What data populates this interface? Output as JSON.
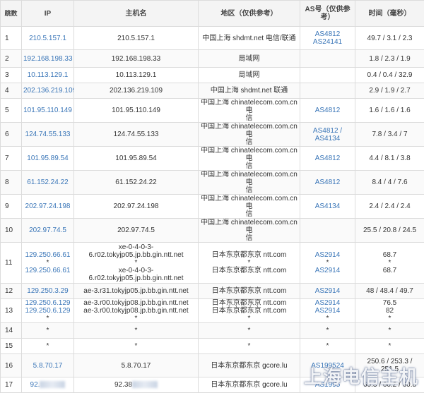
{
  "headers": {
    "hop": "跳数",
    "ip": "IP",
    "host": "主机名",
    "region": "地区（仅供参考）",
    "as": "AS号（仅供参考）",
    "time": "时间（毫秒）"
  },
  "rows": [
    {
      "hop": "1",
      "ip": [
        "210.5.157.1"
      ],
      "host": [
        "210.5.157.1"
      ],
      "region": [
        "中国上海 shdmt.net 电信/联通"
      ],
      "as": [
        "AS4812",
        "AS24141"
      ],
      "time": [
        "49.7 / 3.1 / 2.3"
      ]
    },
    {
      "hop": "2",
      "ip": [
        "192.168.198.33"
      ],
      "host": [
        "192.168.198.33"
      ],
      "region": [
        "局域网"
      ],
      "as": [],
      "time": [
        "1.8 / 2.3 / 1.9"
      ]
    },
    {
      "hop": "3",
      "ip": [
        "10.113.129.1"
      ],
      "host": [
        "10.113.129.1"
      ],
      "region": [
        "局域网"
      ],
      "as": [],
      "time": [
        "0.4 / 0.4 / 32.9"
      ]
    },
    {
      "hop": "4",
      "ip": [
        "202.136.219.109"
      ],
      "host": [
        "202.136.219.109"
      ],
      "region": [
        "中国上海 shdmt.net 联通"
      ],
      "as": [],
      "time": [
        "2.9 / 1.9 / 2.7"
      ]
    },
    {
      "hop": "5",
      "ip": [
        "101.95.110.149"
      ],
      "host": [
        "101.95.110.149"
      ],
      "region": [
        "中国上海 chinatelecom.com.cn 电",
        "信"
      ],
      "as": [
        "AS4812"
      ],
      "time": [
        "1.6 / 1.6 / 1.6"
      ]
    },
    {
      "hop": "6",
      "ip": [
        "124.74.55.133"
      ],
      "host": [
        "124.74.55.133"
      ],
      "region": [
        "中国上海 chinatelecom.com.cn 电",
        "信"
      ],
      "as": [
        "AS4812 / AS4134"
      ],
      "time": [
        "7.8 / 3.4 / 7"
      ]
    },
    {
      "hop": "7",
      "ip": [
        "101.95.89.54"
      ],
      "host": [
        "101.95.89.54"
      ],
      "region": [
        "中国上海 chinatelecom.com.cn 电",
        "信"
      ],
      "as": [
        "AS4812"
      ],
      "time": [
        "4.4 / 8.1 / 3.8"
      ]
    },
    {
      "hop": "8",
      "ip": [
        "61.152.24.22"
      ],
      "host": [
        "61.152.24.22"
      ],
      "region": [
        "中国上海 chinatelecom.com.cn 电",
        "信"
      ],
      "as": [
        "AS4812"
      ],
      "time": [
        "8.4 / 4 / 7.6"
      ]
    },
    {
      "hop": "9",
      "ip": [
        "202.97.24.198"
      ],
      "host": [
        "202.97.24.198"
      ],
      "region": [
        "中国上海 chinatelecom.com.cn 电",
        "信"
      ],
      "as": [
        "AS4134"
      ],
      "time": [
        "2.4 / 2.4 / 2.4"
      ]
    },
    {
      "hop": "10",
      "ip": [
        "202.97.74.5"
      ],
      "host": [
        "202.97.74.5"
      ],
      "region": [
        "中国上海 chinatelecom.com.cn 电",
        "信"
      ],
      "as": [],
      "time": [
        "25.5 / 20.8 / 24.5"
      ]
    },
    {
      "hop": "11",
      "ip": [
        "129.250.66.61",
        "*",
        "129.250.66.61"
      ],
      "host": [
        "xe-0-4-0-3-",
        "6.r02.tokyjp05.jp.bb.gin.ntt.net",
        "*",
        "xe-0-4-0-3-",
        "6.r02.tokyjp05.jp.bb.gin.ntt.net"
      ],
      "region": [
        "日本东京都东京 ntt.com",
        "*",
        "日本东京都东京 ntt.com"
      ],
      "as": [
        "AS2914",
        "*",
        "AS2914"
      ],
      "time": [
        "68.7",
        "*",
        "68.7"
      ]
    },
    {
      "hop": "12",
      "ip": [
        "129.250.3.29"
      ],
      "host": [
        "ae-3.r31.tokyjp05.jp.bb.gin.ntt.net"
      ],
      "region": [
        "日本东京都东京 ntt.com"
      ],
      "as": [
        "AS2914"
      ],
      "time": [
        "48 / 48.4 / 49.7"
      ]
    },
    {
      "hop": "13",
      "ip": [
        "129.250.6.129",
        "129.250.6.129",
        "*"
      ],
      "host": [
        "ae-3.r00.tokyjp08.jp.bb.gin.ntt.net",
        "ae-3.r00.tokyjp08.jp.bb.gin.ntt.net",
        "*"
      ],
      "region": [
        "日本东京都东京 ntt.com",
        "日本东京都东京 ntt.com",
        "*"
      ],
      "as": [
        "AS2914",
        "AS2914",
        "*"
      ],
      "time": [
        "76.5",
        "82",
        "*"
      ]
    },
    {
      "hop": "14",
      "ip": [
        "*"
      ],
      "host": [
        "*"
      ],
      "region": [
        "*"
      ],
      "as": [
        "*"
      ],
      "time": [
        "*"
      ]
    },
    {
      "hop": "15",
      "ip": [
        "*"
      ],
      "host": [
        "*"
      ],
      "region": [
        "*"
      ],
      "as": [
        "*"
      ],
      "time": [
        "*"
      ]
    },
    {
      "hop": "16",
      "ip": [
        "5.8.70.17"
      ],
      "host": [
        "5.8.70.17"
      ],
      "region": [
        "日本东京都东京 gcore.lu"
      ],
      "as": [
        "AS199524"
      ],
      "time": [
        "250.6 / 253.3 /",
        "251.5"
      ]
    },
    {
      "hop": "17",
      "ip": [
        "92."
      ],
      "host": [
        "92.38"
      ],
      "region": [
        "日本东京都东京 gcore.lu"
      ],
      "as": [
        "AS1995"
      ],
      "time": [
        "60.3 / 60.2 / 60.8"
      ]
    }
  ],
  "watermark": "上海电信主机"
}
